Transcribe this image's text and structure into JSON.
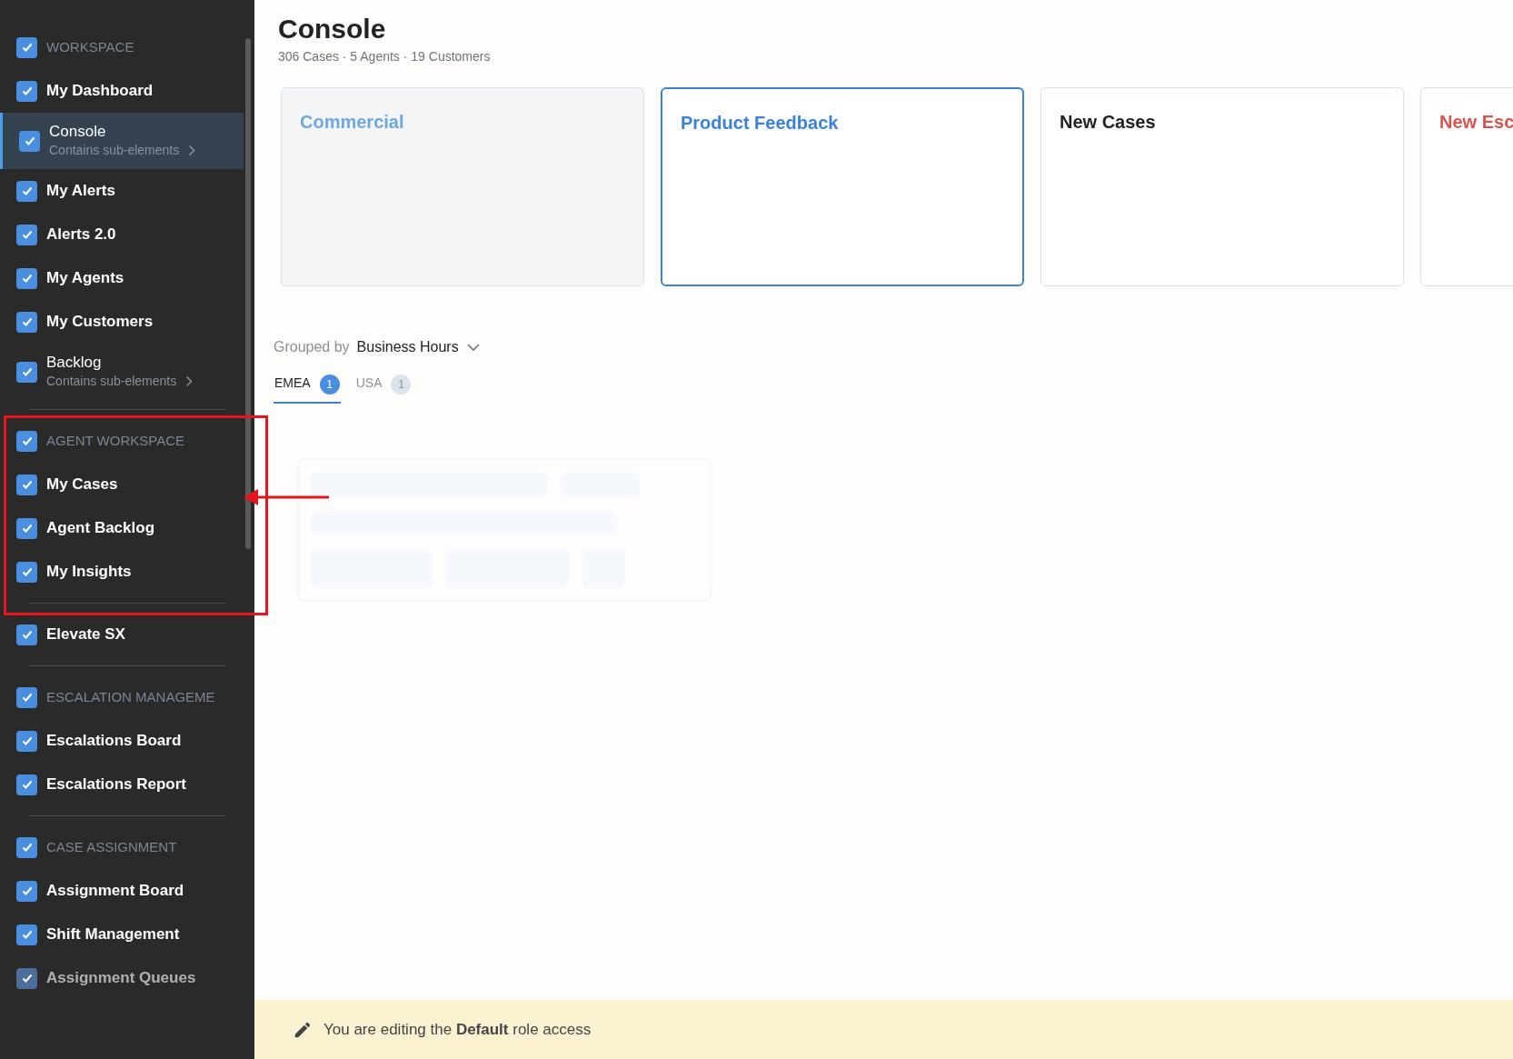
{
  "sidebar": {
    "groups": [
      {
        "items": [
          {
            "kind": "header",
            "label": "WORKSPACE",
            "checked": true,
            "selected": false,
            "disabled": false
          },
          {
            "kind": "item",
            "label": "My Dashboard",
            "checked": true,
            "selected": false,
            "disabled": false
          },
          {
            "kind": "item",
            "label": "Console",
            "sub": "Contains sub-elements",
            "checked": true,
            "selected": true,
            "disabled": false
          },
          {
            "kind": "item",
            "label": "My Alerts",
            "checked": true,
            "selected": false,
            "disabled": false
          },
          {
            "kind": "item",
            "label": "Alerts 2.0",
            "checked": true,
            "selected": false,
            "disabled": false
          },
          {
            "kind": "item",
            "label": "My Agents",
            "checked": true,
            "selected": false,
            "disabled": false
          },
          {
            "kind": "item",
            "label": "My Customers",
            "checked": true,
            "selected": false,
            "disabled": false
          },
          {
            "kind": "item",
            "label": "Backlog",
            "sub": "Contains sub-elements",
            "checked": true,
            "selected": false,
            "disabled": false
          }
        ]
      },
      {
        "items": [
          {
            "kind": "header",
            "label": "AGENT WORKSPACE",
            "checked": true,
            "selected": false,
            "disabled": false
          },
          {
            "kind": "item",
            "label": "My Cases",
            "checked": true,
            "selected": false,
            "disabled": false
          },
          {
            "kind": "item",
            "label": "Agent Backlog",
            "checked": true,
            "selected": false,
            "disabled": false
          },
          {
            "kind": "item",
            "label": "My Insights",
            "checked": true,
            "selected": false,
            "disabled": false
          }
        ]
      },
      {
        "items": [
          {
            "kind": "item",
            "label": "Elevate SX",
            "checked": true,
            "selected": false,
            "disabled": false
          }
        ]
      },
      {
        "items": [
          {
            "kind": "header",
            "label": "ESCALATION MANAGEME",
            "checked": true,
            "selected": false,
            "disabled": false
          },
          {
            "kind": "item",
            "label": "Escalations Board",
            "checked": true,
            "selected": false,
            "disabled": false
          },
          {
            "kind": "item",
            "label": "Escalations Report",
            "checked": true,
            "selected": false,
            "disabled": false
          }
        ]
      },
      {
        "items": [
          {
            "kind": "header",
            "label": "CASE ASSIGNMENT",
            "checked": true,
            "selected": false,
            "disabled": false
          },
          {
            "kind": "item",
            "label": "Assignment Board",
            "checked": true,
            "selected": false,
            "disabled": false
          },
          {
            "kind": "item",
            "label": "Shift Management",
            "checked": true,
            "selected": false,
            "disabled": false
          },
          {
            "kind": "item",
            "label": "Assignment Queues",
            "checked": true,
            "selected": false,
            "disabled": true
          }
        ]
      }
    ]
  },
  "page": {
    "title": "Console",
    "subtitle": "306 Cases · 5 Agents · 19 Customers"
  },
  "cards": [
    {
      "title": "Commercial",
      "color": "#6fa8e0",
      "selected": false,
      "disabled": true
    },
    {
      "title": "Product Feedback",
      "color": "#3b82d6",
      "selected": true,
      "disabled": false
    },
    {
      "title": "New Cases",
      "color": "#222222",
      "selected": false,
      "disabled": false
    },
    {
      "title": "New Esc",
      "color": "#d9534f",
      "selected": false,
      "disabled": false
    }
  ],
  "grouping": {
    "label": "Grouped by",
    "value": "Business Hours"
  },
  "tabs": [
    {
      "label": "EMEA",
      "count": "1",
      "selected": true
    },
    {
      "label": "USA",
      "count": "1",
      "selected": false
    }
  ],
  "footer": {
    "text": "You are editing the **Default** role access"
  },
  "annotations": {
    "highlight_frame": true,
    "arrow": true
  }
}
